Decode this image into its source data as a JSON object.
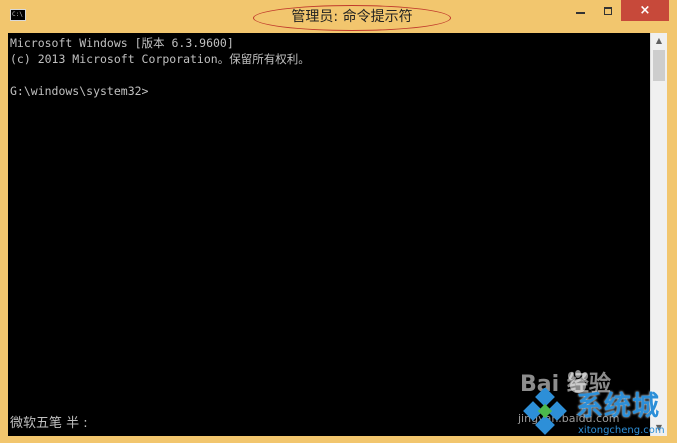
{
  "window": {
    "title": "管理员: 命令提示符",
    "icon_name": "cmd-icon",
    "icon_label": "C:\\",
    "controls": {
      "minimize": "minimize-icon",
      "maximize": "maximize-icon",
      "close": "×"
    },
    "accent_close": "#c7493a",
    "frame_color": "#f2c66e"
  },
  "console": {
    "lines": [
      "Microsoft Windows [版本 6.3.9600]",
      "(c) 2013 Microsoft Corporation。保留所有权利。",
      "",
      "G:\\windows\\system32>"
    ],
    "ime_status": "微软五笔 半 :",
    "background": "#000000",
    "foreground": "#c0c0c0"
  },
  "scrollbar": {
    "up_arrow": "▲",
    "down_arrow": "▼"
  },
  "watermark": {
    "baidu_text": "Bai  经验",
    "baidu_url": "jingyan.baidu.com",
    "brand_text": "系统城",
    "brand_domain": "xitongcheng.com"
  }
}
